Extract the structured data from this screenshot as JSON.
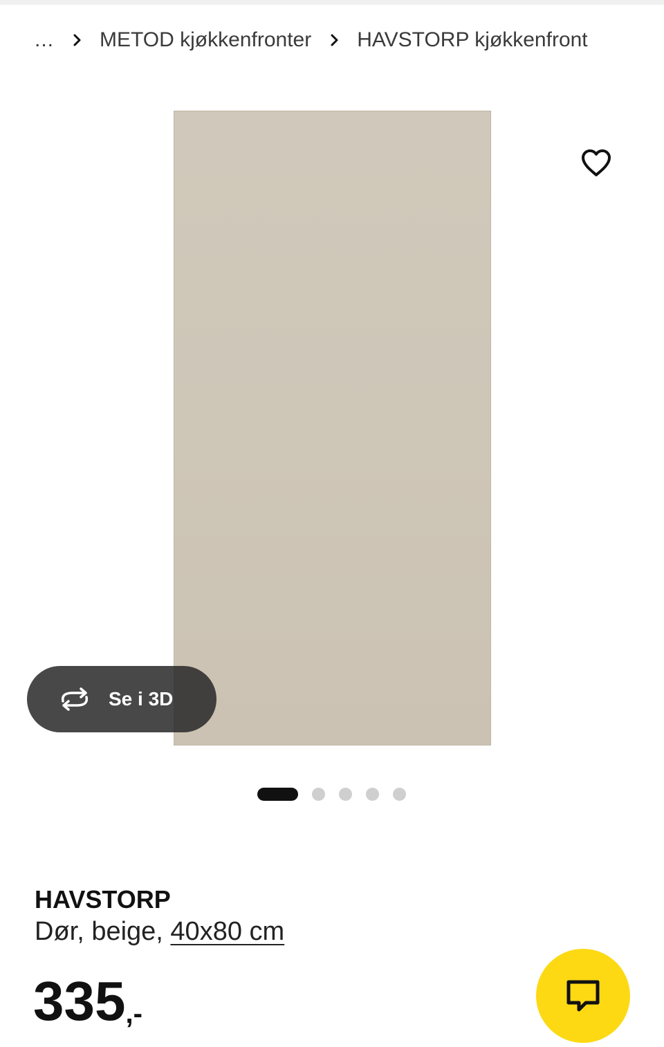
{
  "breadcrumb": {
    "ellipsis": "...",
    "items": [
      {
        "label": "METOD kjøkkenfronter"
      },
      {
        "label": "HAVSTORP kjøkkenfront"
      }
    ]
  },
  "gallery": {
    "favorite_icon": "heart-outline-icon",
    "view3d_label": "Se i 3D",
    "view3d_icon": "rotate-arrows-icon",
    "pagination": {
      "current": 1,
      "total": 5
    },
    "image_color": "#cec6b7"
  },
  "product": {
    "name": "HAVSTORP",
    "description": "Dør, beige, ",
    "size": "40x80 cm",
    "price": "335",
    "price_suffix": ",-"
  },
  "chat": {
    "icon": "chat-bubble-icon",
    "color": "#fcd913"
  }
}
